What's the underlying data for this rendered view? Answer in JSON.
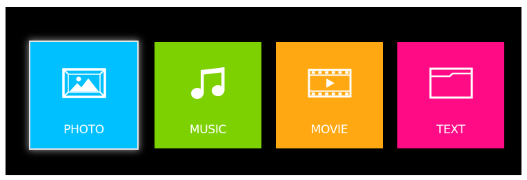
{
  "menu": {
    "tiles": [
      {
        "label": "PHOTO",
        "icon": "photo-icon",
        "color": "#00c0ff",
        "selected": true
      },
      {
        "label": "MUSIC",
        "icon": "music-note-icon",
        "color": "#7ed100",
        "selected": false
      },
      {
        "label": "MOVIE",
        "icon": "film-play-icon",
        "color": "#ffa812",
        "selected": false
      },
      {
        "label": "TEXT",
        "icon": "folder-icon",
        "color": "#ff0b86",
        "selected": false
      }
    ]
  }
}
